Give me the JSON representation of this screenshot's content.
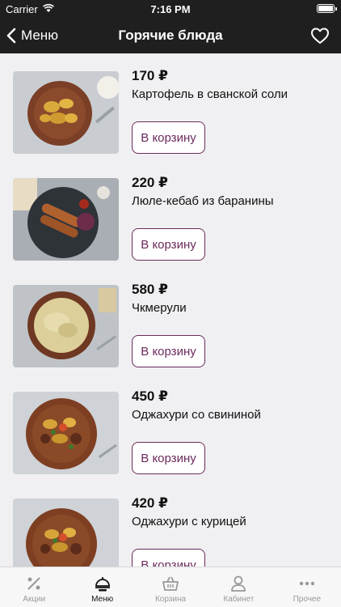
{
  "status": {
    "carrier": "Carrier",
    "time": "7:16 PM"
  },
  "nav": {
    "back_label": "Меню",
    "title": "Горячие блюда"
  },
  "cart_label": "В корзину",
  "items": [
    {
      "price": "170 ₽",
      "name": "Картофель в сванской соли"
    },
    {
      "price": "220 ₽",
      "name": "Люле-кебаб из баранины"
    },
    {
      "price": "580 ₽",
      "name": "Чкмерули"
    },
    {
      "price": "450 ₽",
      "name": "Оджахури со свининой"
    },
    {
      "price": "420 ₽",
      "name": "Оджахури с курицей"
    }
  ],
  "tabs": [
    {
      "label": "Акции",
      "icon": "percent-icon",
      "active": false
    },
    {
      "label": "Меню",
      "icon": "menu-food-icon",
      "active": true
    },
    {
      "label": "Корзина",
      "icon": "basket-icon",
      "active": false
    },
    {
      "label": "Кабинет",
      "icon": "user-icon",
      "active": false
    },
    {
      "label": "Прочее",
      "icon": "more-icon",
      "active": false
    }
  ],
  "colors": {
    "accent": "#6b2a5c",
    "bar": "#1f1f1f",
    "background": "#f0f0f2"
  }
}
